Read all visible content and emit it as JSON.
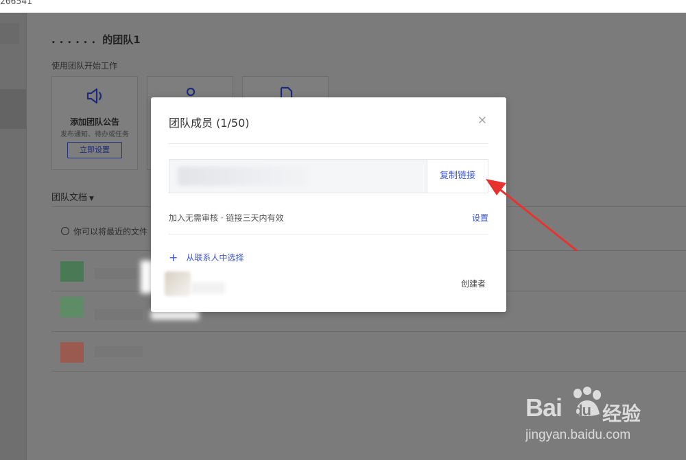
{
  "browser": {
    "url_fragment": "206541"
  },
  "team": {
    "title_dots": "......",
    "title": "的团队1",
    "subtitle": "使用团队开始工作"
  },
  "cards": [
    {
      "icon": "speaker-icon",
      "title": "添加团队公告",
      "desc": "发布通知、待办或任务",
      "button": "立即设置"
    },
    {
      "icon": "person-icon"
    },
    {
      "icon": "document-icon"
    }
  ],
  "docs": {
    "heading": "团队文档",
    "hint": "你可以将最近的文件"
  },
  "modal": {
    "title": "团队成员 (1/50)",
    "copy_link": "复制链接",
    "note": "加入无需审核 · 链接三天内有效",
    "settings": "设置",
    "add_from_contacts": "从联系人中选择",
    "member_role": "创建者"
  },
  "watermark": {
    "brand": "Bai",
    "brand_suffix": "du",
    "product": "经验",
    "url": "jingyan.baidu.com"
  },
  "colors": {
    "link_blue": "#3a56d6",
    "arrow_red": "#e8322f",
    "overlay_gray": "#7b7b7b"
  }
}
